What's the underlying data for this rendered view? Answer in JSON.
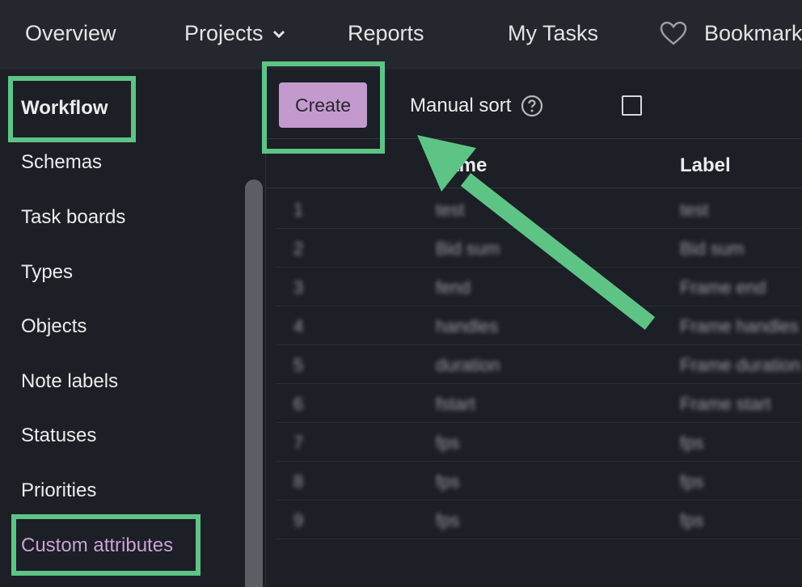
{
  "nav": {
    "overview": "Overview",
    "projects": "Projects",
    "reports": "Reports",
    "my_tasks": "My Tasks",
    "bookmarks": "Bookmarks"
  },
  "sidebar": {
    "items": [
      {
        "label": "Workflow"
      },
      {
        "label": "Schemas"
      },
      {
        "label": "Task boards"
      },
      {
        "label": "Types"
      },
      {
        "label": "Objects"
      },
      {
        "label": "Note labels"
      },
      {
        "label": "Statuses"
      },
      {
        "label": "Priorities"
      },
      {
        "label": "Custom attributes"
      }
    ]
  },
  "toolbar": {
    "create_label": "Create",
    "manual_sort_label": "Manual sort"
  },
  "table": {
    "headers": [
      "Name",
      "Label"
    ],
    "rows": [
      {
        "index": "1",
        "name": "test",
        "label": "test"
      },
      {
        "index": "2",
        "name": "Bid sum",
        "label": "Bid sum"
      },
      {
        "index": "3",
        "name": "fend",
        "label": "Frame end"
      },
      {
        "index": "4",
        "name": "handles",
        "label": "Frame handles"
      },
      {
        "index": "5",
        "name": "duration",
        "label": "Frame duration"
      },
      {
        "index": "6",
        "name": "fstart",
        "label": "Frame start"
      },
      {
        "index": "7",
        "name": "fps",
        "label": "fps"
      },
      {
        "index": "8",
        "name": "fps",
        "label": "fps"
      },
      {
        "index": "9",
        "name": "fps",
        "label": "fps"
      }
    ]
  },
  "colors": {
    "highlight": "#5ec486",
    "accent": "#c39ace",
    "active_text": "#c8a2d6"
  },
  "icons": [
    "chevron-down-icon",
    "heart-icon",
    "help-circle-icon",
    "checkbox-icon"
  ]
}
